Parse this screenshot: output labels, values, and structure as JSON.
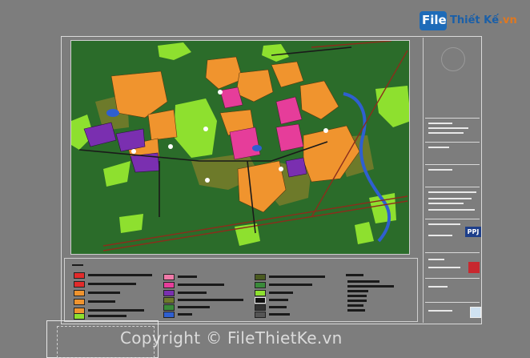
{
  "logo": {
    "badge_text": "File",
    "word_main": "Thiết Kế",
    "word_suffix": ".vn"
  },
  "watermark": {
    "text": "Copyright © FileThietKe.vn"
  },
  "titleblock": {
    "badge_text": "PPJ"
  },
  "colors": {
    "canvas": "#7d7d7d",
    "forest": "#2b6c2a",
    "light_green": "#8ee02f",
    "orange": "#f0942e",
    "pink": "#e63d9a",
    "purple": "#7a2fb0",
    "olive": "#6d7a2a",
    "water": "#2f5fd0",
    "road": "#8b2d1c"
  }
}
